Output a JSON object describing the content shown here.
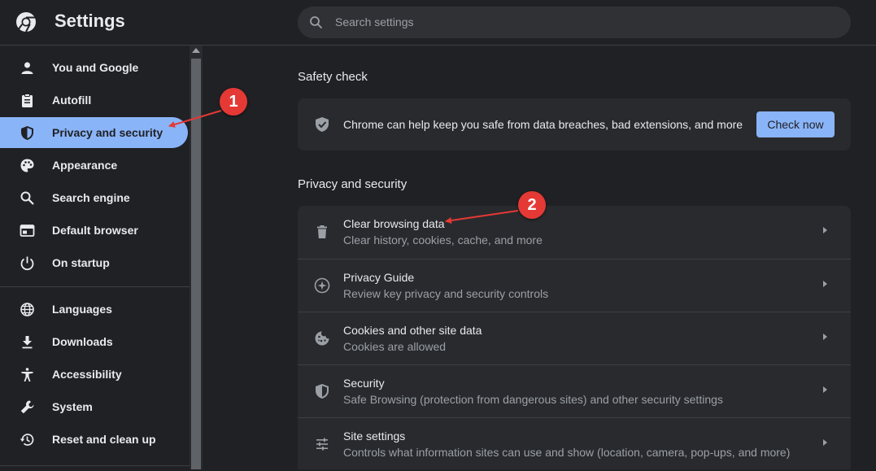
{
  "app": {
    "title": "Settings"
  },
  "search": {
    "placeholder": "Search settings"
  },
  "sidebar": {
    "items": [
      {
        "label": "You and Google",
        "icon": "person-icon"
      },
      {
        "label": "Autofill",
        "icon": "clipboard-icon"
      },
      {
        "label": "Privacy and security",
        "icon": "shield-icon",
        "active": true
      },
      {
        "label": "Appearance",
        "icon": "palette-icon"
      },
      {
        "label": "Search engine",
        "icon": "search-icon"
      },
      {
        "label": "Default browser",
        "icon": "browser-window-icon"
      },
      {
        "label": "On startup",
        "icon": "power-icon"
      },
      {
        "label": "Languages",
        "icon": "globe-icon"
      },
      {
        "label": "Downloads",
        "icon": "download-icon"
      },
      {
        "label": "Accessibility",
        "icon": "accessibility-icon"
      },
      {
        "label": "System",
        "icon": "wrench-icon"
      },
      {
        "label": "Reset and clean up",
        "icon": "history-icon"
      }
    ]
  },
  "safety_check": {
    "title": "Safety check",
    "description": "Chrome can help keep you safe from data breaches, bad extensions, and more",
    "button_label": "Check now"
  },
  "privacy": {
    "title": "Privacy and security",
    "rows": [
      {
        "title": "Clear browsing data",
        "subtitle": "Clear history, cookies, cache, and more",
        "icon": "trash-icon"
      },
      {
        "title": "Privacy Guide",
        "subtitle": "Review key privacy and security controls",
        "icon": "compass-icon"
      },
      {
        "title": "Cookies and other site data",
        "subtitle": "Cookies are allowed",
        "icon": "cookie-icon"
      },
      {
        "title": "Security",
        "subtitle": "Safe Browsing (protection from dangerous sites) and other security settings",
        "icon": "shield-icon"
      },
      {
        "title": "Site settings",
        "subtitle": "Controls what information sites can use and show (location, camera, pop-ups, and more)",
        "icon": "tune-icon"
      }
    ]
  },
  "annotations": {
    "marker_1": "1",
    "marker_2": "2",
    "color": "#e53935"
  },
  "colors": {
    "accent": "#8ab4f8",
    "background": "#202124",
    "card": "#292a2d"
  }
}
